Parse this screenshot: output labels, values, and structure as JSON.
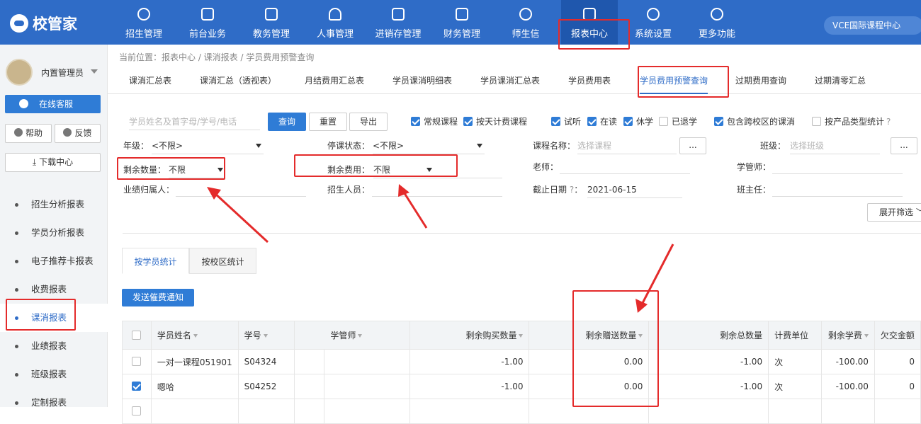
{
  "app": {
    "logo_text": "校管家",
    "campus": "VCE国际课程中心"
  },
  "nav": [
    {
      "label": "招生管理",
      "icon": "person-add-icon"
    },
    {
      "label": "前台业务",
      "icon": "reception-icon"
    },
    {
      "label": "教务管理",
      "icon": "book-icon"
    },
    {
      "label": "人事管理",
      "icon": "person-icon"
    },
    {
      "label": "进销存管理",
      "icon": "inventory-icon"
    },
    {
      "label": "财务管理",
      "icon": "money-icon"
    },
    {
      "label": "师生信",
      "icon": "message-icon"
    },
    {
      "label": "报表中心",
      "icon": "report-icon"
    },
    {
      "label": "系统设置",
      "icon": "gear-icon"
    },
    {
      "label": "更多功能",
      "icon": "more-icon"
    }
  ],
  "sidebar": {
    "user": "内置管理员",
    "service": "在线客服",
    "help": "帮助",
    "feedback": "反馈",
    "download": "下载中心",
    "items": [
      "招生分析报表",
      "学员分析报表",
      "电子推荐卡报表",
      "收费报表",
      "课消报表",
      "业绩报表",
      "班级报表",
      "定制报表"
    ]
  },
  "breadcrumb": "当前位置：报表中心 / 课消报表 / 学员费用预警查询",
  "tabs": [
    "课消汇总表",
    "课消汇总（透视表）",
    "月结费用汇总表",
    "学员课消明细表",
    "学员课消汇总表",
    "学员费用表",
    "学员费用预警查询",
    "过期费用查询",
    "过期清零汇总"
  ],
  "filters": {
    "search_placeholder": "学员姓名及首字母/学号/电话",
    "query": "查询",
    "reset": "重置",
    "export": "导出",
    "checks": [
      {
        "label": "常规课程",
        "checked": true
      },
      {
        "label": "按天计费课程",
        "checked": true
      },
      {
        "label": "试听",
        "checked": true
      },
      {
        "label": "在读",
        "checked": true
      },
      {
        "label": "休学",
        "checked": true
      },
      {
        "label": "已退学",
        "checked": false
      },
      {
        "label": "包含跨校区的课消",
        "checked": true
      },
      {
        "label": "按产品类型统计",
        "checked": false
      }
    ],
    "grade_label": "年级：",
    "grade_value": "<不限>",
    "stop_label": "停课状态：",
    "stop_value": "<不限>",
    "course_label": "课程名称：",
    "course_placeholder": "选择课程",
    "class_label": "班级：",
    "class_placeholder": "选择班级",
    "remain_qty_label": "剩余数量：",
    "remain_qty_value": "不限",
    "remain_fee_label": "剩余费用：",
    "remain_fee_value": "不限",
    "teacher_label": "老师：",
    "manager_label": "学管师：",
    "owner_label": "业绩归属人：",
    "recruiter_label": "招生人员：",
    "deadline_label": "截止日期",
    "deadline_value": "2021-06-15",
    "headteacher_label": "班主任：",
    "expand": "展开筛选",
    "dots": "..."
  },
  "bottom_tabs": [
    "按学员统计",
    "按校区统计"
  ],
  "notify_button": "发送催费通知",
  "table": {
    "headers": [
      "学员姓名",
      "学号",
      "学管师",
      "剩余购买数量",
      "剩余赠送数量",
      "剩余总数量",
      "计费单位",
      "剩余学费",
      "欠交金额"
    ],
    "rows": [
      {
        "checked": false,
        "name": "一对一课程051901",
        "id": "S04324",
        "manager": "",
        "buy": "-1.00",
        "gift": "0.00",
        "total": "-1.00",
        "unit": "次",
        "fee": "-100.00",
        "owe": "0"
      },
      {
        "checked": true,
        "name": "嗯哈",
        "id": "S04252",
        "manager": "",
        "buy": "-1.00",
        "gift": "0.00",
        "total": "-1.00",
        "unit": "次",
        "fee": "-100.00",
        "owe": "0"
      }
    ]
  },
  "colors": {
    "primary": "#2f6cc7",
    "annotation": "#e42b2b"
  }
}
